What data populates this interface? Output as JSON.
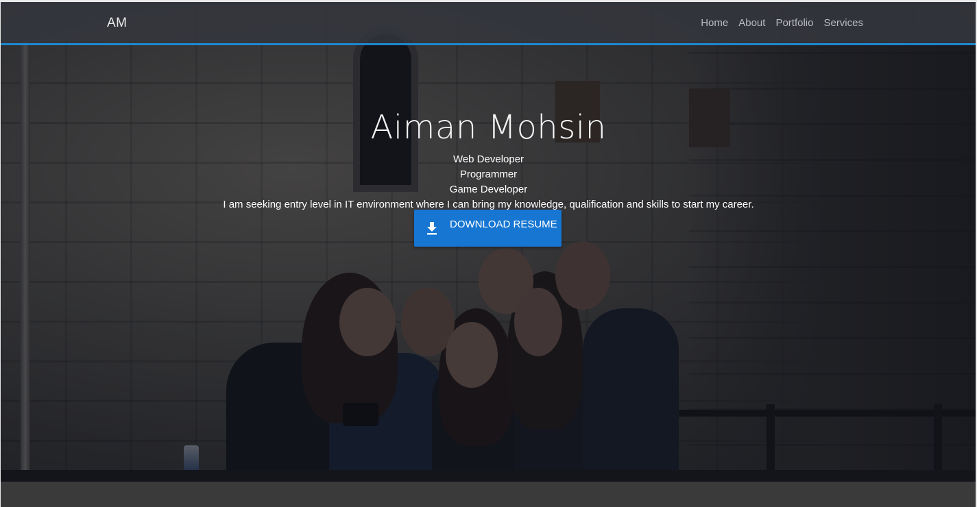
{
  "navbar": {
    "brand": "AM",
    "links": [
      "Home",
      "About",
      "Portfolio",
      "Services"
    ]
  },
  "hero": {
    "name": "Aiman Mohsin",
    "roles": [
      "Web Developer",
      "Programmer",
      "Game Developer"
    ],
    "summary": "I am seeking entry level in IT environment where I can bring my knowledge, qualification and skills to start my career.",
    "button_label": "DOWNLOAD RESUME",
    "button_icon": "download-icon"
  },
  "colors": {
    "accent": "#1e88d0",
    "button": "#1676d2",
    "nav_bg": "#34373e",
    "overlay": "#0e121c"
  }
}
